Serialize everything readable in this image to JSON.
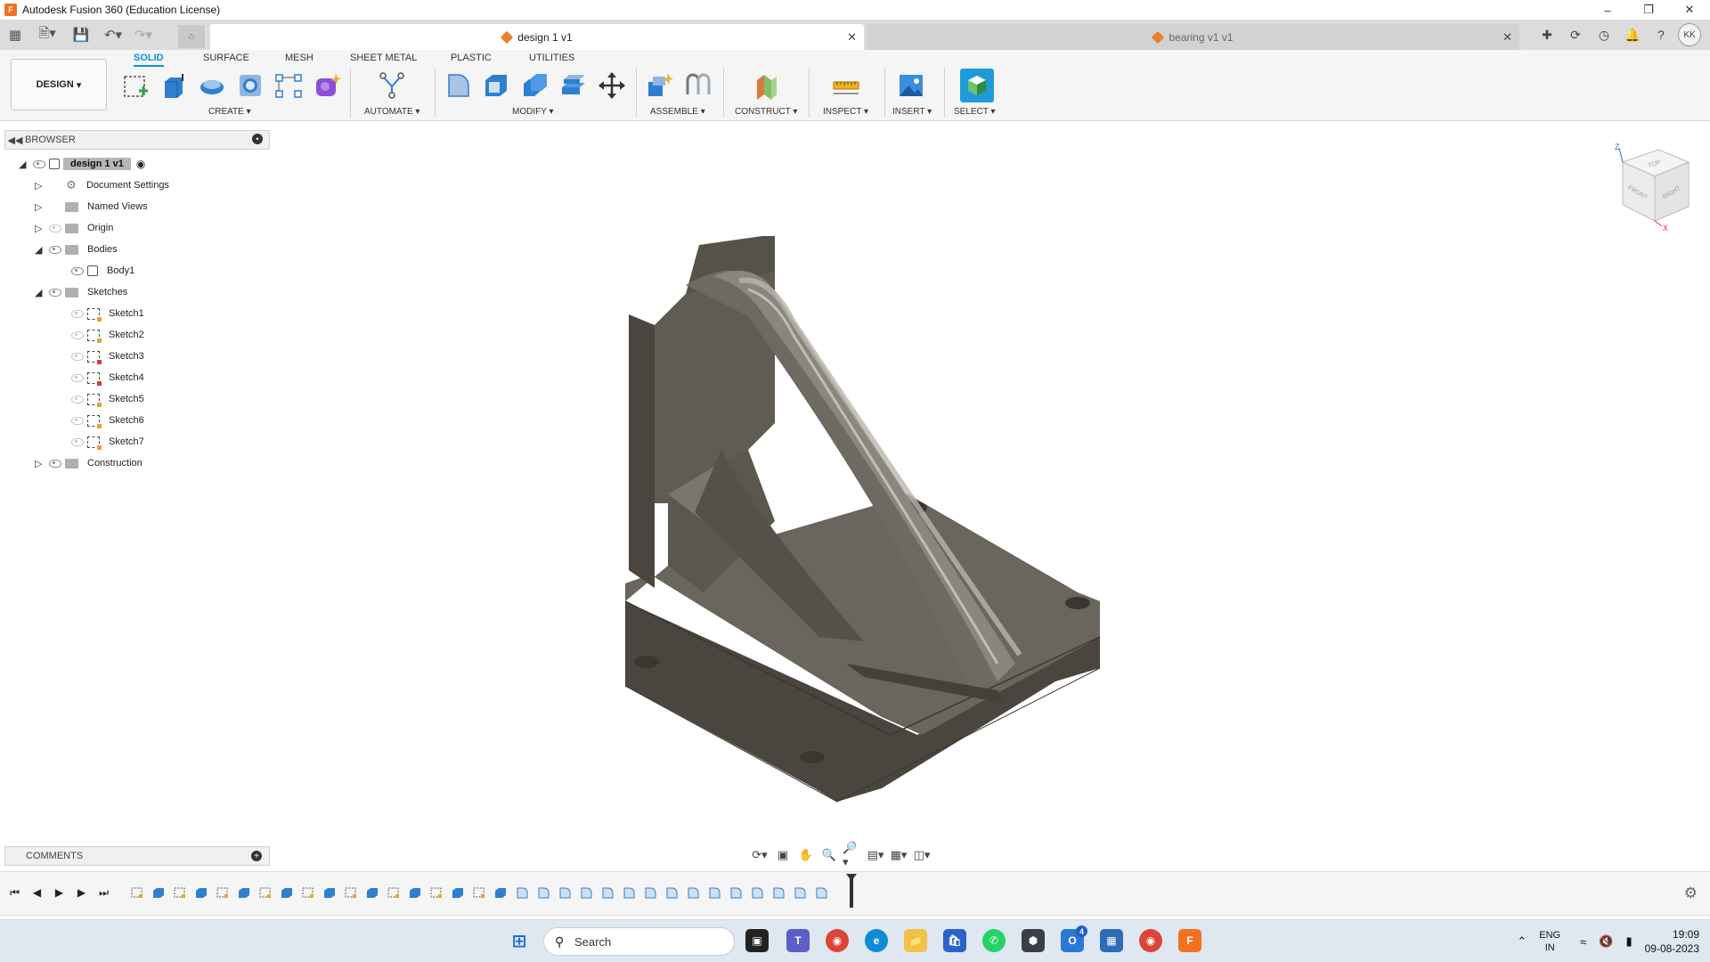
{
  "window": {
    "title": "Autodesk Fusion 360 (Education License)"
  },
  "tabs": [
    {
      "label": "design 1 v1",
      "active": true
    },
    {
      "label": "bearing v1 v1",
      "active": false
    }
  ],
  "user": {
    "initials": "KK"
  },
  "toolbar": {
    "design_label": "DESIGN",
    "workspace_tabs": [
      "SOLID",
      "SURFACE",
      "MESH",
      "SHEET METAL",
      "PLASTIC",
      "UTILITIES"
    ],
    "groups": [
      "CREATE",
      "AUTOMATE",
      "MODIFY",
      "ASSEMBLE",
      "CONSTRUCT",
      "INSPECT",
      "INSERT",
      "SELECT"
    ]
  },
  "browser": {
    "header": "BROWSER",
    "root": "design 1 v1",
    "items": [
      {
        "label": "Document Settings"
      },
      {
        "label": "Named Views"
      },
      {
        "label": "Origin"
      },
      {
        "label": "Bodies"
      },
      {
        "label": "Body1"
      },
      {
        "label": "Sketches"
      },
      {
        "label": "Sketch1"
      },
      {
        "label": "Sketch2"
      },
      {
        "label": "Sketch3"
      },
      {
        "label": "Sketch4"
      },
      {
        "label": "Sketch5"
      },
      {
        "label": "Sketch6"
      },
      {
        "label": "Sketch7"
      },
      {
        "label": "Construction"
      }
    ]
  },
  "comments": {
    "label": "COMMENTS"
  },
  "viewcube": {
    "faces": [
      "TOP",
      "FRONT",
      "RIGHT"
    ],
    "axes": [
      "Z",
      "X"
    ]
  },
  "colors": {
    "accent": "#0696d7",
    "model": "#5e5a52",
    "ui_bg": "#f5f5f5"
  },
  "taskbar": {
    "search_placeholder": "Search",
    "lang": "ENG",
    "region": "IN",
    "time": "19:09",
    "date": "09-08-2023",
    "badge": "4"
  }
}
